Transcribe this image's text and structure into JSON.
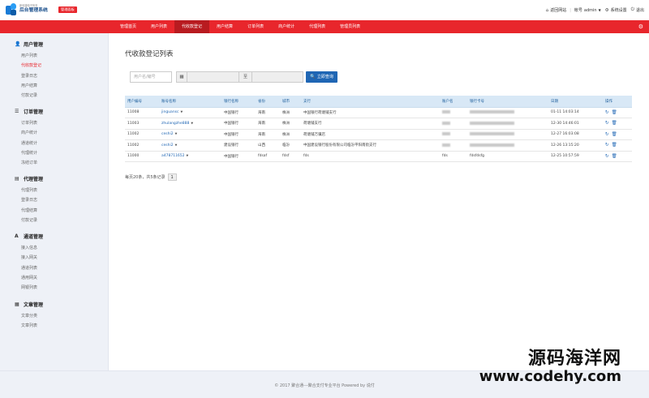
{
  "logo": {
    "tagline": "新利捷电子商务",
    "title": "后台管理系统",
    "badge": "管理面板"
  },
  "top_right": {
    "site_link": "返回网站",
    "account_label": "帐号",
    "username": "admin",
    "settings": "系统设置",
    "logout": "退出"
  },
  "nav": {
    "items": [
      "管理首页",
      "用户列表",
      "代收款登记",
      "用户结算",
      "订单列表",
      "商户统计",
      "代理列表",
      "管理员列表"
    ],
    "active_index": 2
  },
  "sidebar": {
    "groups": [
      {
        "title": "用户管理",
        "icon": "user-icon",
        "items": [
          "用户列表",
          "代收款登记",
          "登录日志",
          "用户结算",
          "付款记录"
        ]
      },
      {
        "title": "订单管理",
        "icon": "list-icon",
        "items": [
          "订单列表",
          "商户统计",
          "通道统计",
          "代理统计",
          "冻结订单"
        ]
      },
      {
        "title": "代理管理",
        "icon": "file-icon",
        "items": [
          "代理列表",
          "登录日志",
          "代理结算",
          "付款记录"
        ]
      },
      {
        "title": "通道管理",
        "icon": "font-icon",
        "items": [
          "接入信息",
          "接入网关",
          "通道列表",
          "通用网关",
          "网银列表"
        ]
      },
      {
        "title": "文章管理",
        "icon": "book-icon",
        "items": [
          "文章分类",
          "文章列表"
        ]
      }
    ],
    "active_item": "代收款登记"
  },
  "main": {
    "title": "代收款登记列表",
    "filters": {
      "user_placeholder": "用户名/编号",
      "date_to": "至",
      "search_button": "立即查询"
    },
    "table": {
      "headers": [
        "用户编号",
        "账号名称",
        "银行名称",
        "省份",
        "城市",
        "支行",
        "账户名",
        "银行卡号",
        "日期",
        "操作"
      ],
      "rows": [
        {
          "id": "11008",
          "account": "jinguansc",
          "bank": "中国银行",
          "province": "海南",
          "city": "株洲",
          "branch": "中国银行荷塘铺支行",
          "holder": "",
          "card": "",
          "date": "01-11 14:03:14"
        },
        {
          "id": "11003",
          "account": "zhulangzhe888",
          "bank": "中国银行",
          "province": "海南",
          "city": "株洲",
          "branch": "荷塘铺支行",
          "holder": "",
          "card": "",
          "date": "12-30 14:46:01"
        },
        {
          "id": "11002",
          "account": "ceshi2",
          "bank": "中国银行",
          "province": "海南",
          "city": "株洲",
          "branch": "荷塘铺万骥店",
          "holder": "",
          "card": "",
          "date": "12-27 16:03:08"
        },
        {
          "id": "11002",
          "account": "ceshi2",
          "bank": "建设银行",
          "province": "山西",
          "city": "临汾",
          "branch": "中国建设银行股份有限公司临汾平阳南街支行",
          "holder": "",
          "card": "",
          "date": "12-26 13:15:20"
        },
        {
          "id": "11000",
          "account": "a478711652",
          "bank": "中国银行",
          "province": "fdsaf",
          "city": "fdsf",
          "branch": "fds",
          "holder": "fds",
          "card": "fdsfdsfg",
          "date": "12-25 10:57:59"
        }
      ]
    },
    "pager": {
      "summary": "每页20条，共5条记录",
      "current_page": "1"
    }
  },
  "footer": {
    "text": "© 2017  聚合通---聚合支付专业平台 Powered by 说付"
  },
  "watermark": {
    "line1": "源码海洋网",
    "line2": "www.codehy.com"
  },
  "colors": {
    "brand_red": "#e8262c",
    "nav_active": "#b81b20",
    "link_blue": "#1f66b4",
    "sidebar_bg": "#eef1f7",
    "table_head_bg": "#d8e8f6"
  }
}
